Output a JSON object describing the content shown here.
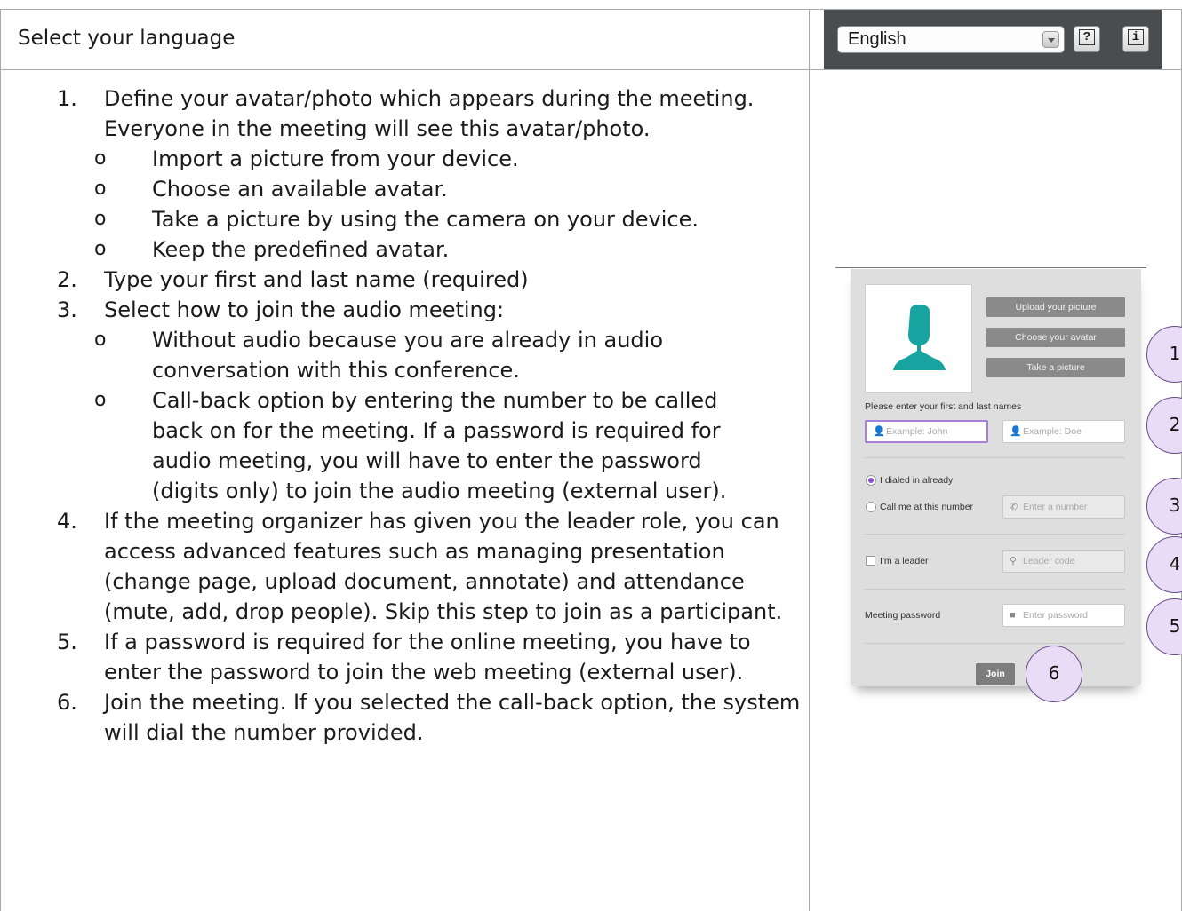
{
  "header": {
    "title": "Select your language",
    "language": "English",
    "help_label": "?",
    "info_label": "i"
  },
  "instructions": {
    "steps": [
      {
        "num": "1.",
        "text": "Define your avatar/photo which appears during the meeting. Everyone in the meeting will see this avatar/photo."
      },
      {
        "num": "2.",
        "text": "Type your first and last name (required)"
      },
      {
        "num": "3.",
        "text": "Select how to join the audio meeting:"
      },
      {
        "num": "4.",
        "text": "If the meeting organizer has given you the leader role, you can access advanced features such as managing presentation (change page, upload document, annotate) and attendance (mute, add, drop people). Skip this step to join as a participant."
      },
      {
        "num": "5.",
        "text": "If a password is required for the online meeting, you have to enter the password to join the web meeting (external user)."
      },
      {
        "num": "6.",
        "text": "Join the meeting. If you selected the call-back option, the system will dial the number provided."
      }
    ],
    "bullet": "o",
    "step1_subs": [
      "Import a picture from your device.",
      "Choose an available avatar.",
      "Take a picture by using the camera on your device.",
      "Keep the predefined avatar."
    ],
    "step3_subs": [
      "Without audio because you are already in audio conversation with this conference.",
      "Call-back option by entering the number to be called back on for the meeting. If a password is required for audio meeting, you will have to enter the password (digits only) to join the audio meeting (external user)."
    ]
  },
  "form": {
    "upload_label": "Upload your picture",
    "avatar_label": "Choose your avatar",
    "take_picture_label": "Take a picture",
    "names_prompt": "Please enter your first and last names",
    "first_name_placeholder": "Example: John",
    "last_name_placeholder": "Example: Doe",
    "dialed_in_label": "I dialed in already",
    "call_me_label": "Call me at this number",
    "number_placeholder": "Enter a number",
    "leader_label": "I'm a leader",
    "leader_code_placeholder": "Leader code",
    "password_label": "Meeting password",
    "password_placeholder": "Enter password",
    "join_label": "Join"
  },
  "callouts": [
    "1",
    "2",
    "3",
    "4",
    "5",
    "6"
  ],
  "colors": {
    "accent": "#8a4fd4",
    "avatar": "#17a3a0",
    "callout_fill": "#e9dcf6",
    "header_bar": "#4a4d50"
  }
}
